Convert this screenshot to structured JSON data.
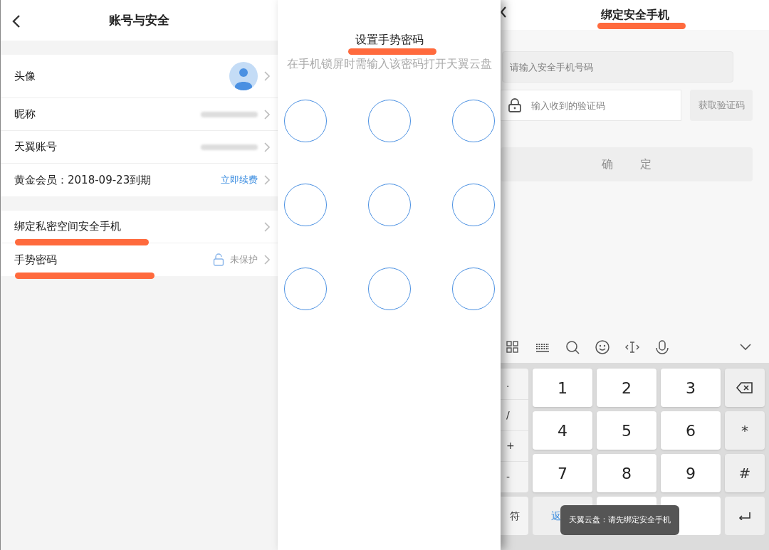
{
  "account_screen": {
    "title": "账号与安全",
    "groups": [
      [
        {
          "kind": "avatar",
          "label": "头像",
          "underlined": false
        },
        {
          "kind": "redacted",
          "label": "昵称",
          "underlined": false
        },
        {
          "kind": "redacted",
          "label": "天翼账号",
          "underlined": false
        },
        {
          "kind": "link",
          "label": "黄金会员：2018-09-23到期",
          "value": "立即续费",
          "underlined": false
        }
      ],
      [
        {
          "kind": "plain",
          "label": "绑定私密空间安全手机",
          "underlined": true
        },
        {
          "kind": "lock",
          "label": "手势密码",
          "value": "未保护",
          "underlined": true
        }
      ]
    ]
  },
  "gesture_screen": {
    "title": "设置手势密码",
    "title_underlined": true,
    "hint": "在手机锁屏时需输入该密码打开天翼云盘"
  },
  "bind_screen": {
    "title": "绑定安全手机",
    "title_underlined": true,
    "phone_placeholder": "请输入安全手机号码",
    "code_placeholder": "输入收到的验证码",
    "get_code_button": {
      "label": "获取验证码",
      "disabled": true
    },
    "confirm_button": {
      "label": "确 定",
      "disabled": true
    }
  },
  "keyboard": {
    "side_keys": [
      ".",
      "/",
      "+",
      "-"
    ],
    "rows": [
      [
        {
          "kind": "digit",
          "label": "1"
        },
        {
          "kind": "digit",
          "label": "2"
        },
        {
          "kind": "digit",
          "label": "3"
        },
        {
          "kind": "backspace"
        }
      ],
      [
        {
          "kind": "digit",
          "label": "4"
        },
        {
          "kind": "digit",
          "label": "5"
        },
        {
          "kind": "digit",
          "label": "6"
        },
        {
          "kind": "symbol",
          "label": "*"
        }
      ],
      [
        {
          "kind": "digit",
          "label": "7"
        },
        {
          "kind": "digit",
          "label": "8"
        },
        {
          "kind": "digit",
          "label": "9"
        },
        {
          "kind": "symbol",
          "label": "#"
        }
      ]
    ],
    "bottom_row": [
      {
        "kind": "symbol",
        "label": "符"
      },
      {
        "kind": "link",
        "label": "返"
      },
      {
        "kind": "blank"
      },
      {
        "kind": "blank"
      },
      {
        "kind": "enter"
      }
    ]
  },
  "toast": "天翼云盘：请先绑定安全手机"
}
